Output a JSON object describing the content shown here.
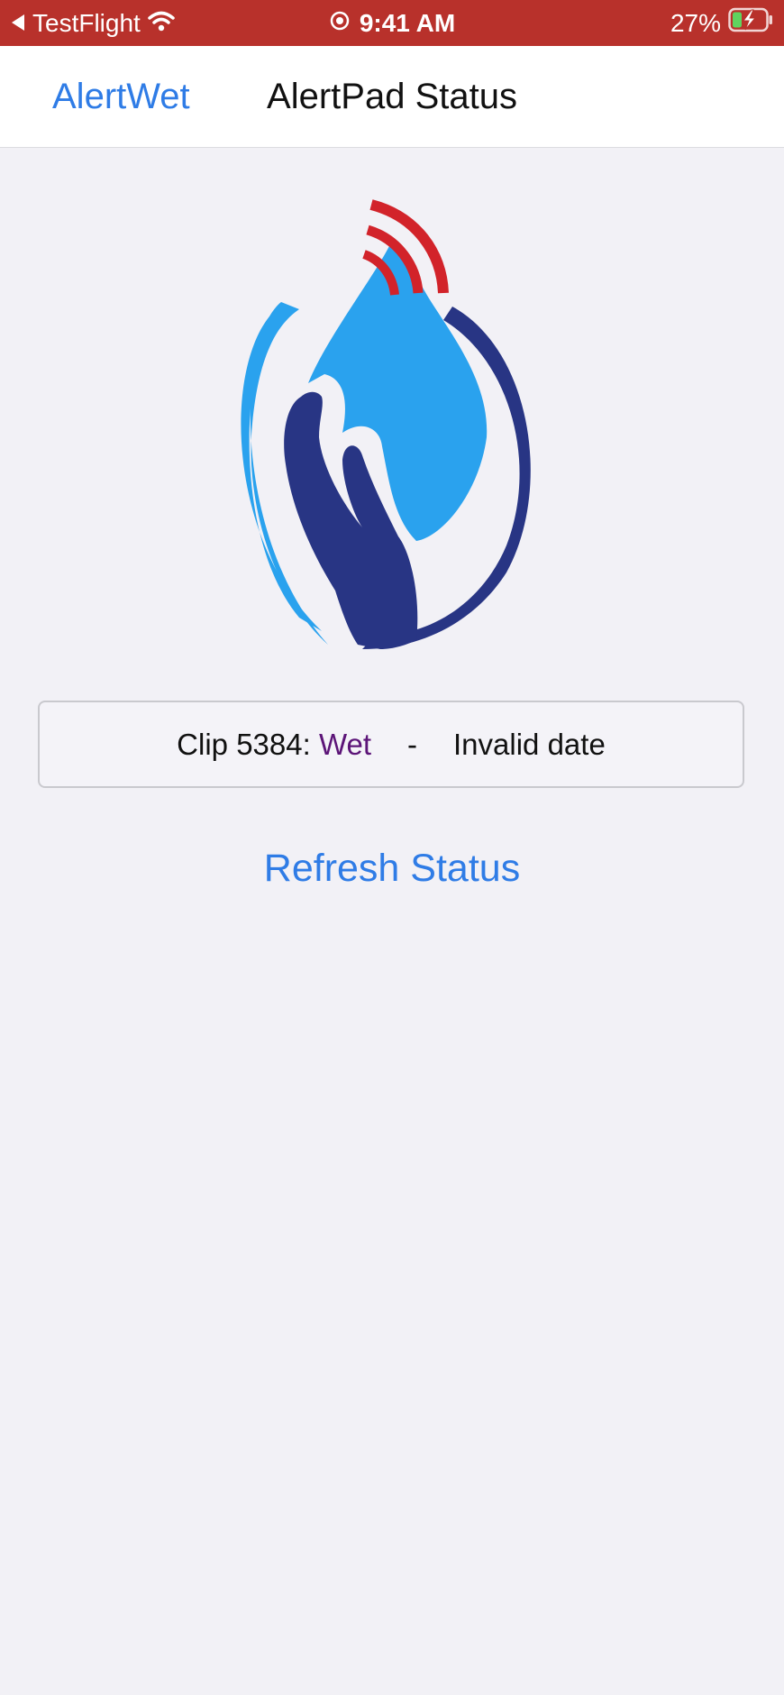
{
  "status_bar": {
    "back_app": "TestFlight",
    "time": "9:41 AM",
    "battery": "27%"
  },
  "nav": {
    "back_label": "AlertWet",
    "title": "AlertPad Status"
  },
  "status_card": {
    "clip_label": "Clip 5384: ",
    "state": "Wet",
    "separator": "-",
    "date": "Invalid date"
  },
  "refresh_label": "Refresh Status",
  "colors": {
    "status_bar_bg": "#b8312b",
    "accent_blue": "#2f7ce6",
    "wet_purple": "#5c1478",
    "drop_blue": "#2aa2ee",
    "hand_navy": "#283584",
    "signal_red": "#d2232a"
  },
  "icons": [
    "back-arrow-icon",
    "wifi-icon",
    "location-icon",
    "battery-icon",
    "charging-bolt-icon",
    "alertwet-logo"
  ]
}
